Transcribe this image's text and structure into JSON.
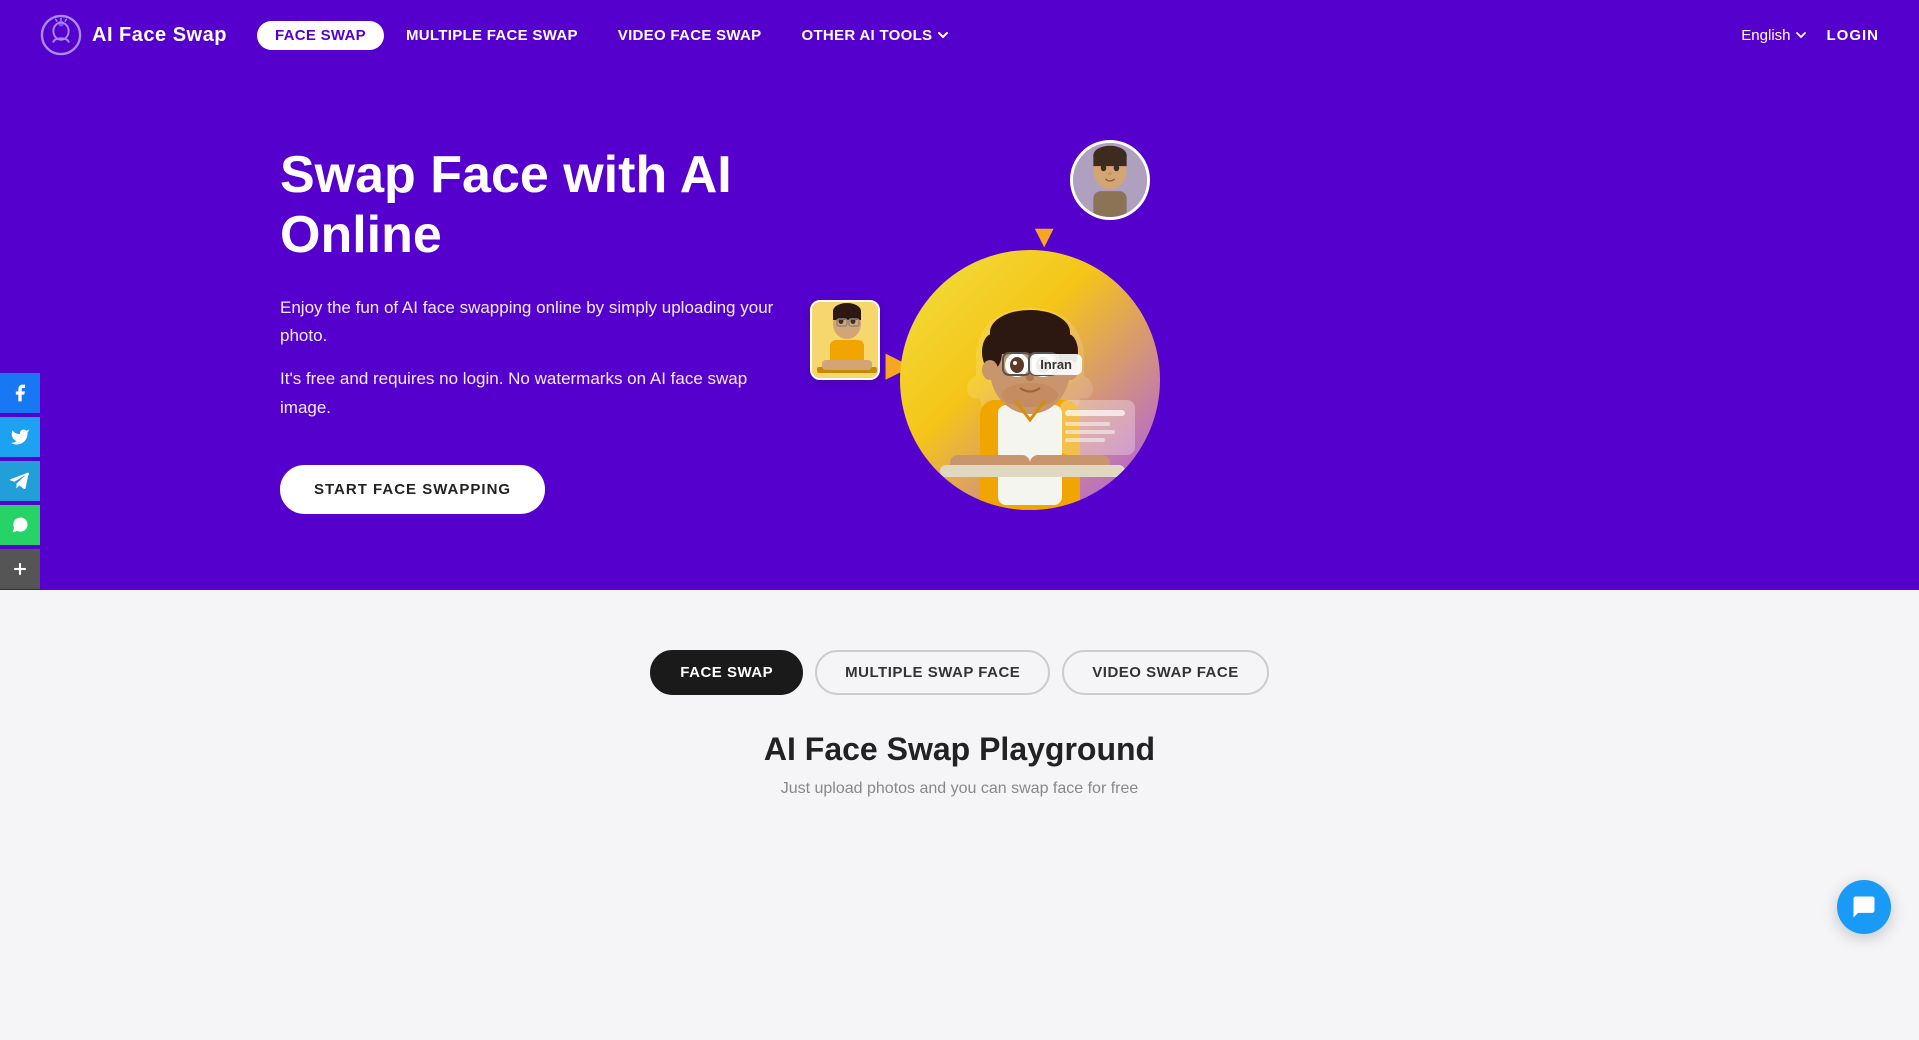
{
  "brand": {
    "logo_text": "AI Face Swap",
    "logo_icon_alt": "brain-icon"
  },
  "nav": {
    "links": [
      {
        "id": "face-swap",
        "label": "FACE SWAP",
        "active": true
      },
      {
        "id": "multiple-face-swap",
        "label": "MULTIPLE FACE SWAP",
        "active": false
      },
      {
        "id": "video-face-swap",
        "label": "VIDEO FACE SWAP",
        "active": false
      },
      {
        "id": "other-ai-tools",
        "label": "OTHER AI TOOLS",
        "active": false,
        "dropdown": true
      }
    ],
    "language": "English",
    "login_label": "LOGIN"
  },
  "hero": {
    "title": "Swap Face with AI Online",
    "desc1": "Enjoy the fun of AI face swapping online by simply uploading your photo.",
    "desc2": "It's free and requires no login. No watermarks on AI face swap image.",
    "cta_label": "START FACE SWAPPING"
  },
  "social": {
    "items": [
      {
        "id": "facebook",
        "icon": "f",
        "label": "Facebook"
      },
      {
        "id": "twitter",
        "icon": "t",
        "label": "Twitter"
      },
      {
        "id": "telegram",
        "icon": "✈",
        "label": "Telegram"
      },
      {
        "id": "whatsapp",
        "icon": "w",
        "label": "WhatsApp"
      },
      {
        "id": "more",
        "icon": "+",
        "label": "More"
      }
    ]
  },
  "lower": {
    "tabs": [
      {
        "id": "face-swap-tab",
        "label": "FACE SWAP",
        "active": true
      },
      {
        "id": "multiple-swap-tab",
        "label": "MULTIPLE SWAP FACE",
        "active": false
      },
      {
        "id": "video-swap-tab",
        "label": "VIDEO SWAP FACE",
        "active": false
      }
    ],
    "section_title": "AI Face Swap Playground",
    "section_subtitle": "Just upload photos and you can swap face for free"
  },
  "chat": {
    "icon_label": "chat-icon"
  }
}
